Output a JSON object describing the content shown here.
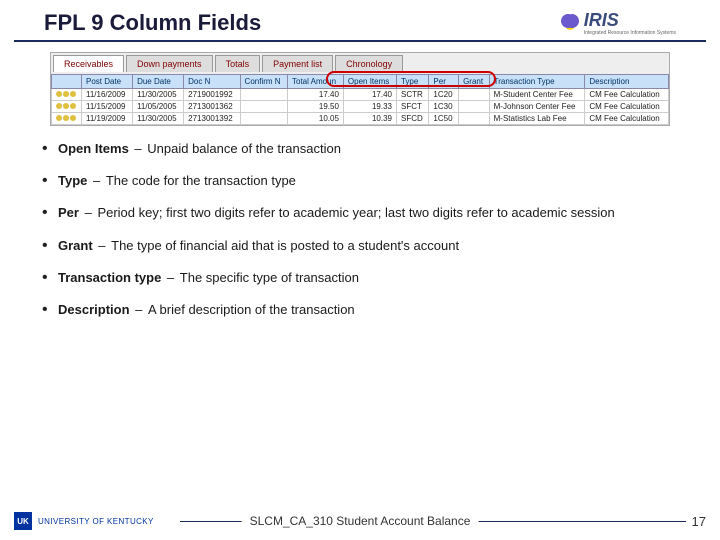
{
  "header": {
    "title": "FPL 9 Column Fields",
    "brand": "IRIS",
    "brand_sub": "Integrated Resource Information Systems"
  },
  "grid": {
    "tabs": [
      "Receivables",
      "Down payments",
      "Totals",
      "Payment list",
      "Chronology"
    ],
    "columns": [
      "Post Date",
      "Due Date",
      "Doc N",
      "Confirm N",
      "Total Amoun",
      "Open Items",
      "Type",
      "Per",
      "Grant",
      "Transaction Type",
      "Description"
    ],
    "rows": [
      {
        "post": "11/16/2009",
        "due": "11/30/2005",
        "doc": "2719001992",
        "conf": "",
        "total": "17.40",
        "open": "17.40",
        "type": "SCTR",
        "per": "1C20",
        "grant": "",
        "ttype": "M-Student Center Fee",
        "desc": "CM Fee Calculation"
      },
      {
        "post": "11/15/2009",
        "due": "11/05/2005",
        "doc": "2713001362",
        "conf": "",
        "total": "19.50",
        "open": "19.33",
        "type": "SFCT",
        "per": "1C30",
        "grant": "",
        "ttype": "M-Johnson Center Fee",
        "desc": "CM Fee Calculation"
      },
      {
        "post": "11/19/2009",
        "due": "11/30/2005",
        "doc": "2713001392",
        "conf": "",
        "total": "10.05",
        "open": "10.39",
        "type": "SFCD",
        "per": "1C50",
        "grant": "",
        "ttype": "M-Statistics Lab Fee",
        "desc": "CM Fee Calculation"
      }
    ]
  },
  "bullets": [
    {
      "term": "Open Items",
      "desc": "Unpaid balance of the transaction"
    },
    {
      "term": "Type",
      "desc": "The code for the transaction type"
    },
    {
      "term": "Per",
      "desc": "Period key; first two digits refer to academic year; last two digits refer to academic session"
    },
    {
      "term": "Grant",
      "desc": "The type of financial aid that is posted to a student's account"
    },
    {
      "term": "Transaction type",
      "desc": "The specific type of transaction"
    },
    {
      "term": "Description",
      "desc": "A brief description of the transaction"
    }
  ],
  "footer": {
    "uk_badge": "UK",
    "uk_text": "UNIVERSITY OF KENTUCKY",
    "course": "SLCM_CA_310 Student Account Balance",
    "page": "17"
  }
}
